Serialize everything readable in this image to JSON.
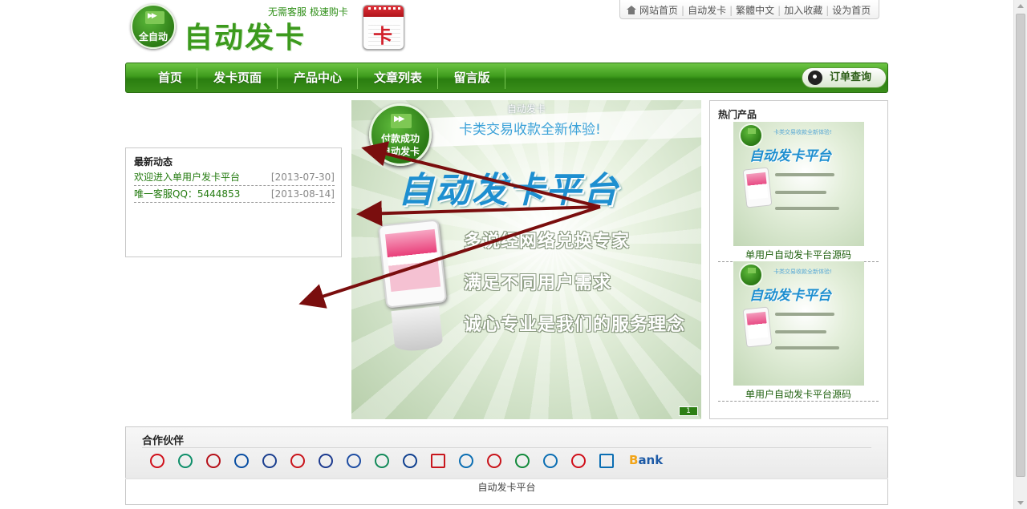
{
  "site": {
    "logo_badge": "全自动",
    "logo_title": "自动发卡",
    "slogan": "无需客服  极速购卡"
  },
  "top_links": [
    "网站首页",
    "自动发卡",
    "繁體中文",
    "加入收藏",
    "设为首页"
  ],
  "nav": {
    "items": [
      "首页",
      "发卡页面",
      "产品中心",
      "文章列表",
      "留言版"
    ],
    "order_button": "订单查询"
  },
  "news": {
    "title": "最新动态",
    "items": [
      {
        "text": "欢迎进入单用户发卡平台",
        "date": "[2013-07-30]"
      },
      {
        "text": "唯一客服QQ：5444853",
        "date": "[2013-08-14]"
      }
    ]
  },
  "banner": {
    "caption": "自动发卡",
    "tagline": "卡类交易收款全新体验!",
    "badge_line1": "付款成功",
    "badge_line2": "自动发卡",
    "headline": "自动发卡平台",
    "features": [
      "多说经网络兑换专家",
      "满足不同用户需求",
      "诚心专业是我们的服务理念"
    ],
    "pager": "1"
  },
  "hot": {
    "title": "热门产品",
    "products": [
      {
        "name": "单用户自动发卡平台源码",
        "img_small": "卡类交易收款全新体验!",
        "img_headline": "自动发卡平台"
      },
      {
        "name": "单用户自动发卡平台源码",
        "img_small": "卡类交易收款全新体验!",
        "img_headline": "自动发卡平台"
      }
    ]
  },
  "partners": {
    "title": "合作伙伴",
    "bank_text_b": "B",
    "bank_text_rest": "ank",
    "banks": [
      {
        "icon": "icbc-logo-icon",
        "color": "#d0101b"
      },
      {
        "icon": "abc-logo-icon",
        "color": "#0f8f6a"
      },
      {
        "icon": "boc-logo-icon",
        "color": "#b6111a"
      },
      {
        "icon": "ccb-logo-icon",
        "color": "#0a4fa3"
      },
      {
        "icon": "comm-bank-logo-icon",
        "color": "#1b3f8f"
      },
      {
        "icon": "cmb-logo-icon",
        "color": "#c9141b"
      },
      {
        "icon": "spdb-logo-icon",
        "color": "#1c3a8f"
      },
      {
        "icon": "cib-logo-icon",
        "color": "#1f4ea3"
      },
      {
        "icon": "sdb-logo-icon",
        "color": "#138a5a"
      },
      {
        "icon": "ceb-logo-icon",
        "color": "#0e3f8f"
      },
      {
        "icon": "citic-logo-icon",
        "color": "#c8161d"
      },
      {
        "icon": "cmbc-logo-icon",
        "color": "#0b6eb3"
      },
      {
        "icon": "gdb-logo-icon",
        "color": "#c9141b"
      },
      {
        "icon": "psbc-logo-icon",
        "color": "#138a3c"
      },
      {
        "icon": "china-mobile-logo-icon",
        "color": "#0b6eb3"
      },
      {
        "icon": "china-unicom-logo-icon",
        "color": "#d0101b"
      },
      {
        "icon": "china-telecom-logo-icon",
        "color": "#0b6eb3"
      }
    ]
  },
  "footer": {
    "text": "自动发卡平台"
  },
  "colors": {
    "brand_green": "#3e9b1c",
    "link_green": "#247b10",
    "arrow_red": "#7a0e0e"
  }
}
